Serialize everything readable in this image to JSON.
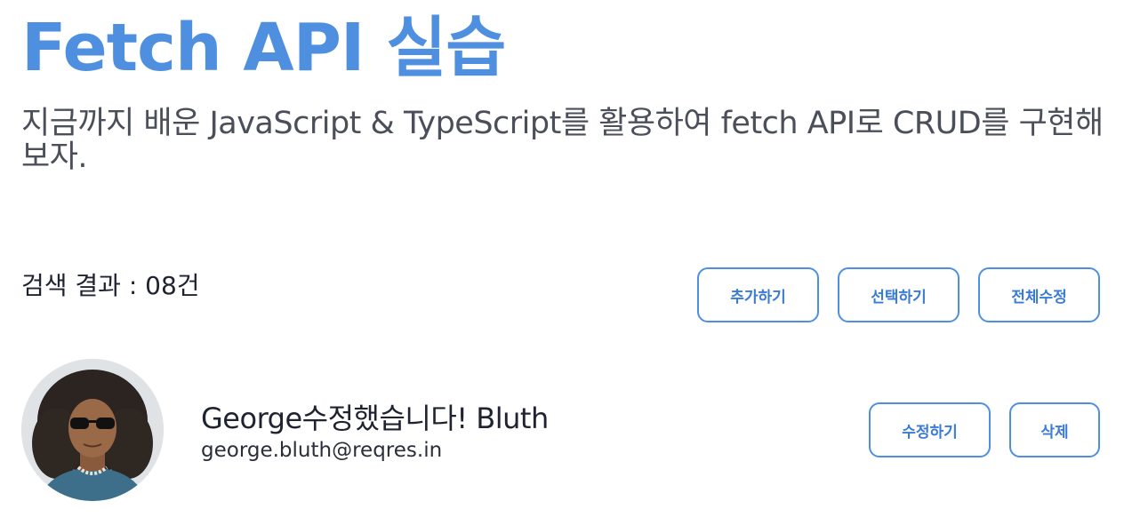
{
  "header": {
    "title": "Fetch API 실습",
    "subtitle": "지금까지 배운 JavaScript & TypeScript를 활용하여 fetch API로 CRUD를 구현해보자."
  },
  "results": {
    "count_text": "검색 결과 : 08건"
  },
  "toolbar": {
    "add_label": "추가하기",
    "select_label": "선택하기",
    "edit_all_label": "전체수정"
  },
  "users": [
    {
      "name": "George수정했습니다! Bluth",
      "email": "george.bluth@reqres.in",
      "edit_label": "수정하기",
      "delete_label": "삭제"
    }
  ],
  "colors": {
    "accent": "#4f8fe0",
    "text": "#1f2330",
    "subtext": "#4b4f5a"
  }
}
